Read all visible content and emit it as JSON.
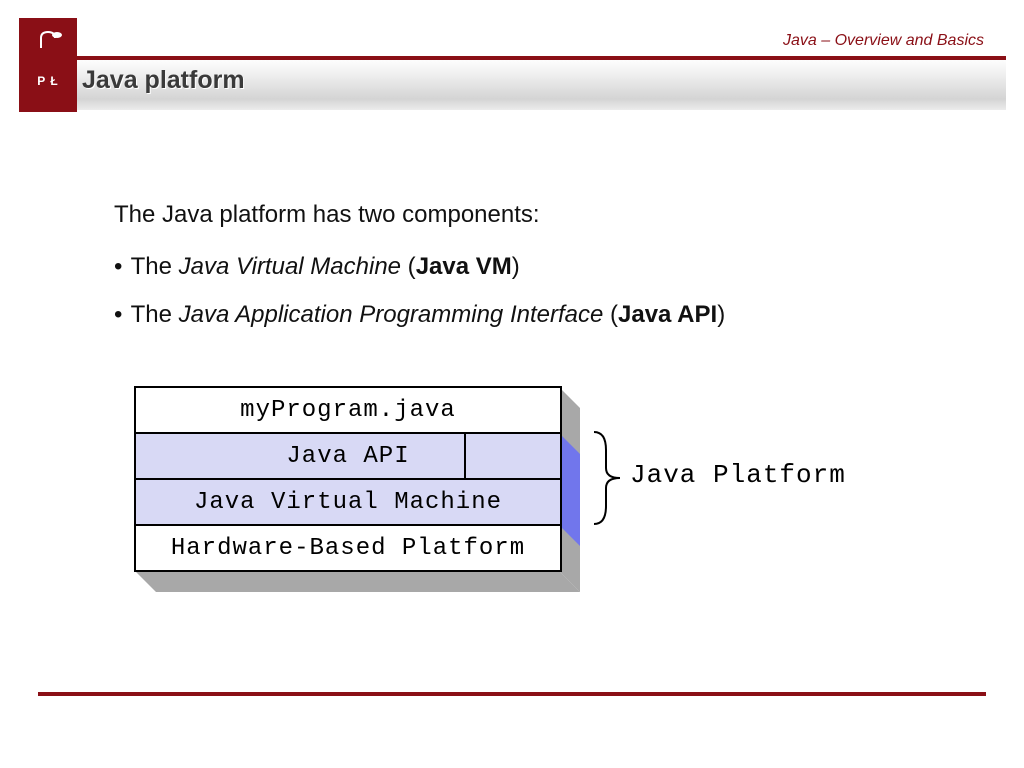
{
  "header": {
    "breadcrumb": "Java – Overview and Basics",
    "title": "Java platform",
    "logo_text": "P Ł"
  },
  "body": {
    "intro": "The Java platform has two components:",
    "bullets": [
      {
        "prefix": "The ",
        "italic": "Java Virtual Machine",
        "mid": " (",
        "bold": "Java VM",
        "suffix": ")"
      },
      {
        "prefix": "The ",
        "italic": "Java Application Programming Interface",
        "mid": " (",
        "bold": "Java API",
        "suffix": ")"
      }
    ]
  },
  "diagram": {
    "layers": [
      "myProgram.java",
      "Java API",
      "Java Virtual Machine",
      "Hardware-Based Platform"
    ],
    "brace_label": "Java Platform"
  },
  "colors": {
    "brand": "#8a0f16",
    "hilite": "#d8d9f5",
    "side": "#a8a8a8",
    "side_hilite": "#7176ec"
  }
}
